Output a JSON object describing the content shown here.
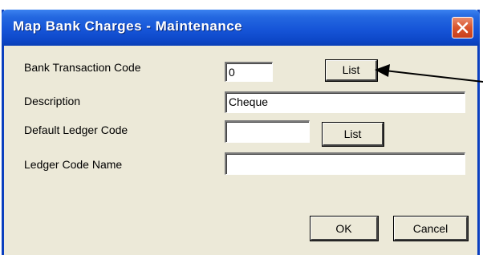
{
  "window": {
    "title": "Map Bank Charges - Maintenance",
    "close_icon": "close-icon"
  },
  "form": {
    "bank_transaction_code": {
      "label": "Bank Transaction Code",
      "value": "0",
      "list_button": "List"
    },
    "description": {
      "label": "Description",
      "value": "Cheque"
    },
    "default_ledger_code": {
      "label": "Default Ledger Code",
      "value": "",
      "list_button": "List"
    },
    "ledger_code_name": {
      "label": "Ledger Code Name",
      "value": ""
    }
  },
  "buttons": {
    "ok": "OK",
    "cancel": "Cancel"
  },
  "colors": {
    "titlebar": "#1655d8",
    "window_bg": "#ece9d8",
    "close": "#d9542c",
    "border": "#0a3fbf"
  }
}
